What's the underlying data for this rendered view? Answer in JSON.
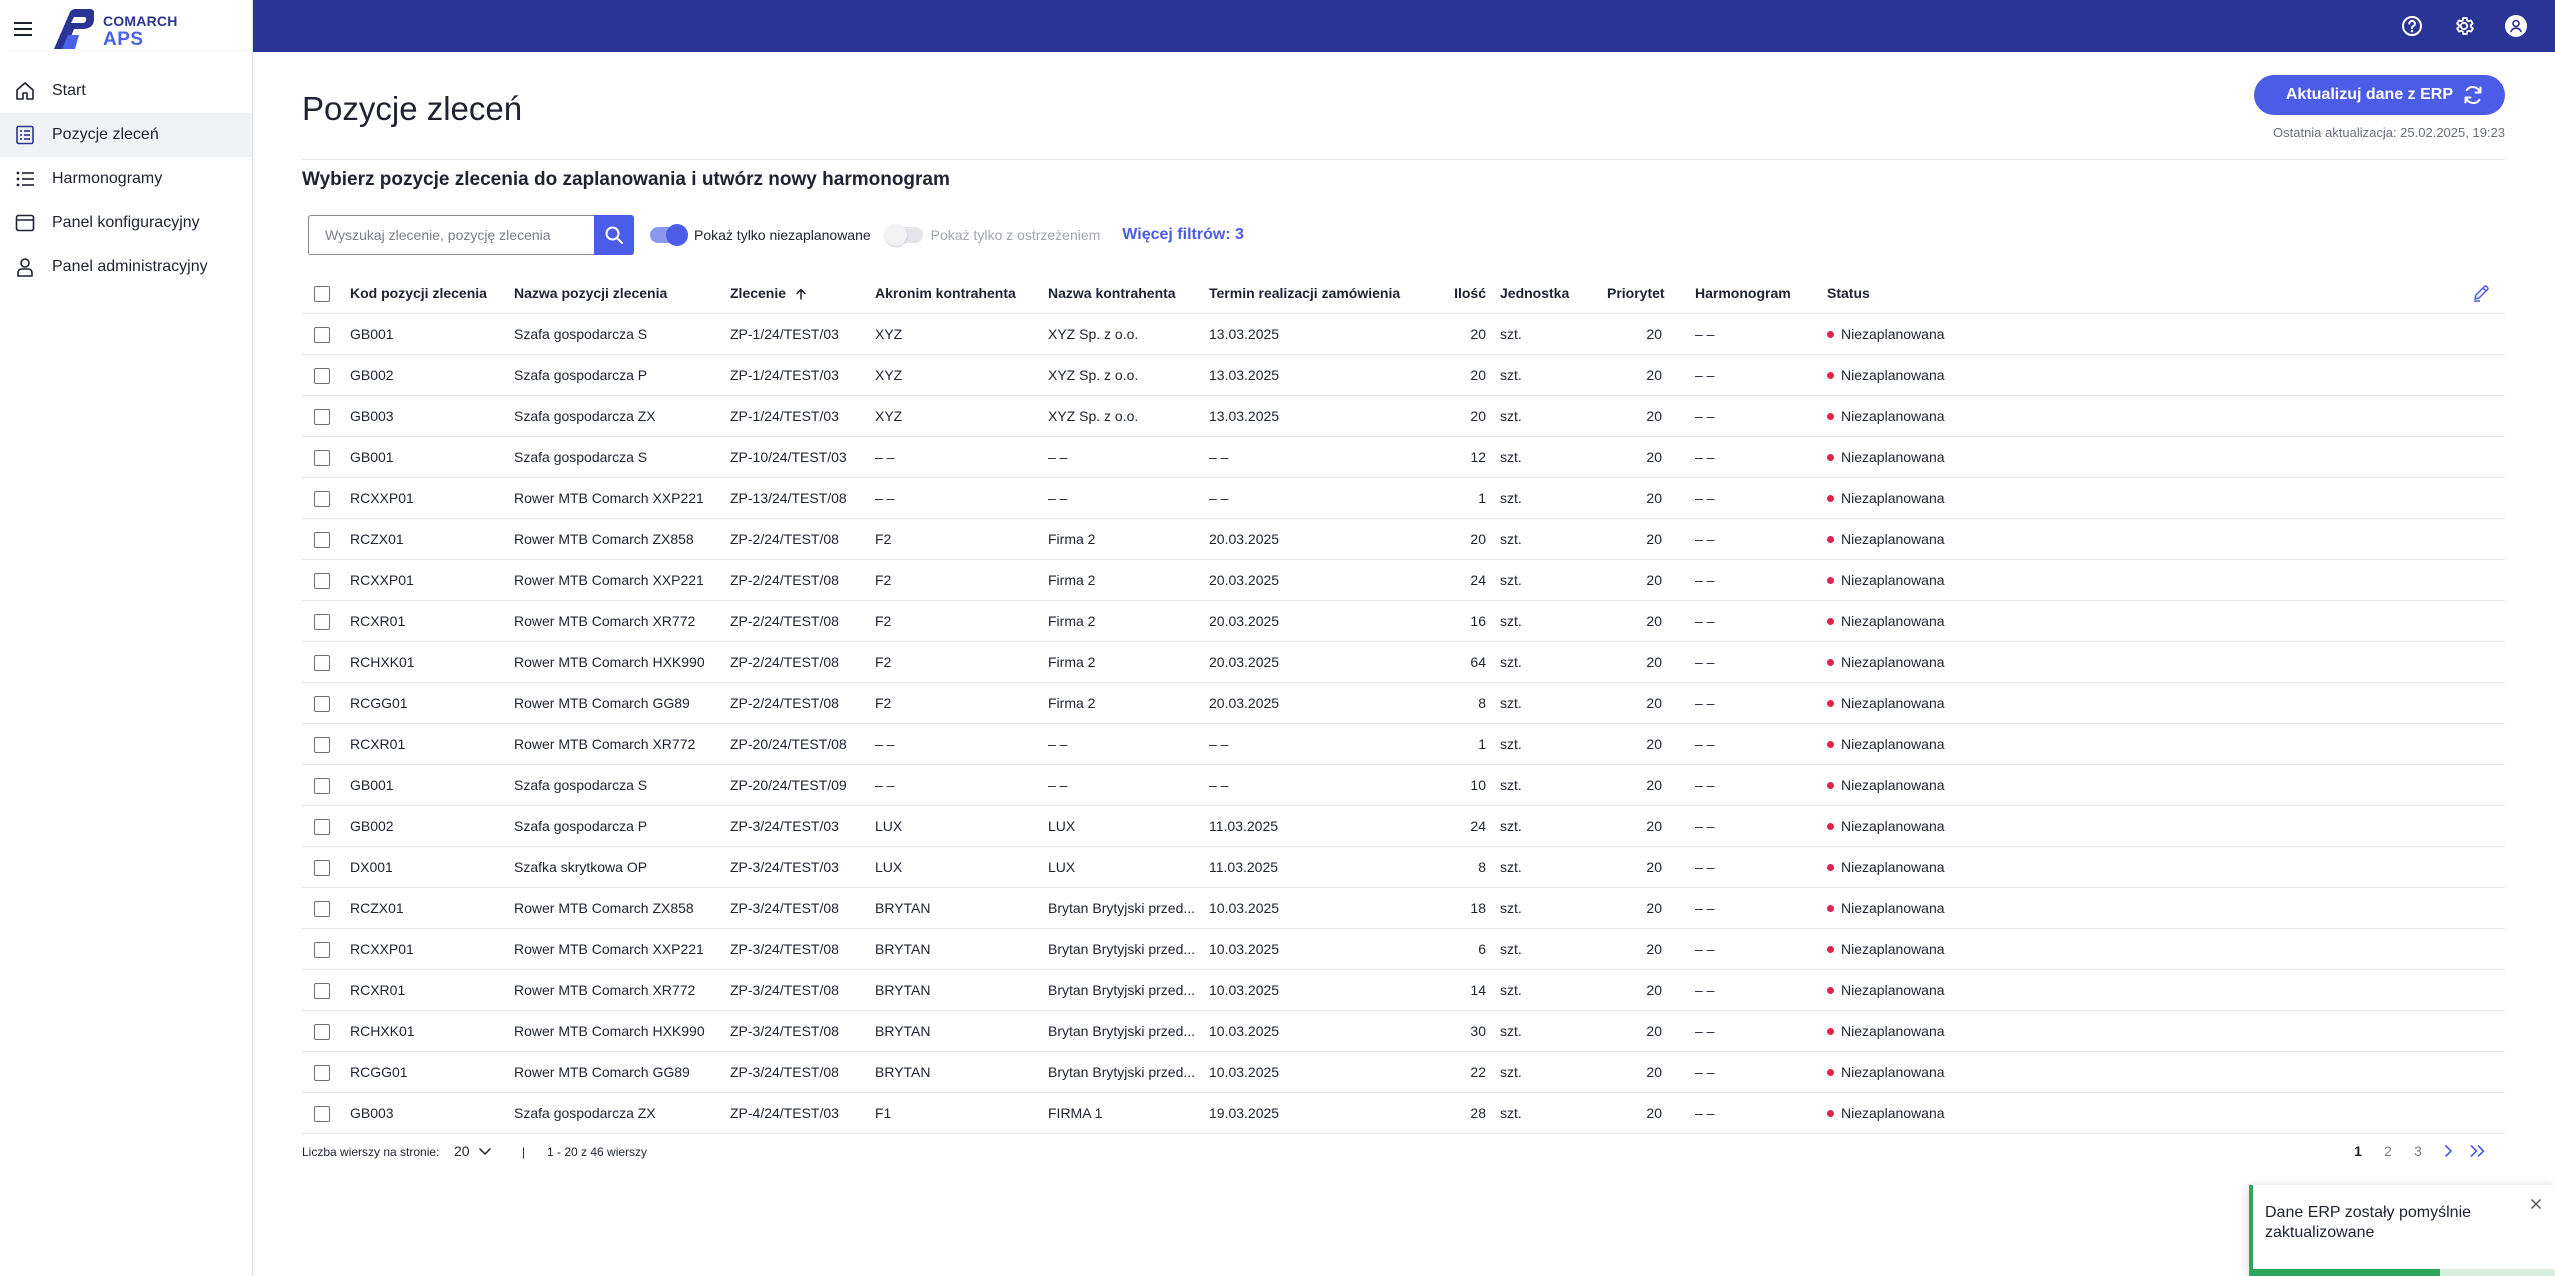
{
  "app": {
    "logo_line1": "COMARCH",
    "logo_line2": "APS"
  },
  "sidebar": {
    "items": [
      {
        "label": "Start",
        "icon": "home-icon"
      },
      {
        "label": "Pozycje zleceń",
        "icon": "list-doc-icon",
        "active": true
      },
      {
        "label": "Harmonogramy",
        "icon": "bullet-list-icon"
      },
      {
        "label": "Panel konfiguracyjny",
        "icon": "window-icon"
      },
      {
        "label": "Panel administracyjny",
        "icon": "person-icon"
      }
    ]
  },
  "header": {
    "title": "Pozycje zleceń",
    "erp_button": "Aktualizuj dane z ERP",
    "last_update": "Ostatnia aktualizacja: 25.02.2025, 19:23",
    "subtitle": "Wybierz pozycje zlecenia do zaplanowania i utwórz nowy harmonogram"
  },
  "filters": {
    "search_placeholder": "Wyszukaj zlecenie, pozycję zlecenia",
    "toggle_unplanned": "Pokaż tylko niezaplanowane",
    "toggle_unplanned_on": true,
    "toggle_warning": "Pokaż tylko z ostrzeżeniem",
    "toggle_warning_on": false,
    "more_filters": "Więcej filtrów: 3"
  },
  "table": {
    "columns": {
      "kod": "Kod pozycji zlecenia",
      "nazwa": "Nazwa pozycji zlecenia",
      "zlecenie": "Zlecenie",
      "akronim": "Akronim kontrahenta",
      "nazwa_kontr": "Nazwa kontrahenta",
      "termin": "Termin realizacji zamówienia",
      "ilosc": "Ilość",
      "jednostka": "Jednostka",
      "priorytet": "Priorytet",
      "harmonogram": "Harmonogram",
      "status": "Status"
    },
    "sorted_by": "zlecenie",
    "status_color": "#e0234e",
    "rows": [
      [
        "GB001",
        "Szafa gospodarcza S",
        "ZP-1/24/TEST/03",
        "XYZ",
        "XYZ Sp. z o.o.",
        "13.03.2025",
        "20",
        "szt.",
        "20",
        "– –",
        "Niezaplanowana"
      ],
      [
        "GB002",
        "Szafa gospodarcza P",
        "ZP-1/24/TEST/03",
        "XYZ",
        "XYZ Sp. z o.o.",
        "13.03.2025",
        "20",
        "szt.",
        "20",
        "– –",
        "Niezaplanowana"
      ],
      [
        "GB003",
        "Szafa gospodarcza ZX",
        "ZP-1/24/TEST/03",
        "XYZ",
        "XYZ Sp. z o.o.",
        "13.03.2025",
        "20",
        "szt.",
        "20",
        "– –",
        "Niezaplanowana"
      ],
      [
        "GB001",
        "Szafa gospodarcza S",
        "ZP-10/24/TEST/03",
        "– –",
        "– –",
        "– –",
        "12",
        "szt.",
        "20",
        "– –",
        "Niezaplanowana"
      ],
      [
        "RCXXP01",
        "Rower MTB Comarch XXP221",
        "ZP-13/24/TEST/08",
        "– –",
        "– –",
        "– –",
        "1",
        "szt.",
        "20",
        "– –",
        "Niezaplanowana"
      ],
      [
        "RCZX01",
        "Rower MTB Comarch ZX858",
        "ZP-2/24/TEST/08",
        "F2",
        "Firma 2",
        "20.03.2025",
        "20",
        "szt.",
        "20",
        "– –",
        "Niezaplanowana"
      ],
      [
        "RCXXP01",
        "Rower MTB Comarch XXP221",
        "ZP-2/24/TEST/08",
        "F2",
        "Firma 2",
        "20.03.2025",
        "24",
        "szt.",
        "20",
        "– –",
        "Niezaplanowana"
      ],
      [
        "RCXR01",
        "Rower MTB Comarch XR772",
        "ZP-2/24/TEST/08",
        "F2",
        "Firma 2",
        "20.03.2025",
        "16",
        "szt.",
        "20",
        "– –",
        "Niezaplanowana"
      ],
      [
        "RCHXK01",
        "Rower MTB Comarch HXK990",
        "ZP-2/24/TEST/08",
        "F2",
        "Firma 2",
        "20.03.2025",
        "64",
        "szt.",
        "20",
        "– –",
        "Niezaplanowana"
      ],
      [
        "RCGG01",
        "Rower MTB Comarch GG89",
        "ZP-2/24/TEST/08",
        "F2",
        "Firma 2",
        "20.03.2025",
        "8",
        "szt.",
        "20",
        "– –",
        "Niezaplanowana"
      ],
      [
        "RCXR01",
        "Rower MTB Comarch XR772",
        "ZP-20/24/TEST/08",
        "– –",
        "– –",
        "– –",
        "1",
        "szt.",
        "20",
        "– –",
        "Niezaplanowana"
      ],
      [
        "GB001",
        "Szafa gospodarcza S",
        "ZP-20/24/TEST/09",
        "– –",
        "– –",
        "– –",
        "10",
        "szt.",
        "20",
        "– –",
        "Niezaplanowana"
      ],
      [
        "GB002",
        "Szafa gospodarcza P",
        "ZP-3/24/TEST/03",
        "LUX",
        "LUX",
        "11.03.2025",
        "24",
        "szt.",
        "20",
        "– –",
        "Niezaplanowana"
      ],
      [
        "DX001",
        "Szafka skrytkowa OP",
        "ZP-3/24/TEST/03",
        "LUX",
        "LUX",
        "11.03.2025",
        "8",
        "szt.",
        "20",
        "– –",
        "Niezaplanowana"
      ],
      [
        "RCZX01",
        "Rower MTB Comarch ZX858",
        "ZP-3/24/TEST/08",
        "BRYTAN",
        "Brytan Brytyjski przed...",
        "10.03.2025",
        "18",
        "szt.",
        "20",
        "– –",
        "Niezaplanowana"
      ],
      [
        "RCXXP01",
        "Rower MTB Comarch XXP221",
        "ZP-3/24/TEST/08",
        "BRYTAN",
        "Brytan Brytyjski przed...",
        "10.03.2025",
        "6",
        "szt.",
        "20",
        "– –",
        "Niezaplanowana"
      ],
      [
        "RCXR01",
        "Rower MTB Comarch XR772",
        "ZP-3/24/TEST/08",
        "BRYTAN",
        "Brytan Brytyjski przed...",
        "10.03.2025",
        "14",
        "szt.",
        "20",
        "– –",
        "Niezaplanowana"
      ],
      [
        "RCHXK01",
        "Rower MTB Comarch HXK990",
        "ZP-3/24/TEST/08",
        "BRYTAN",
        "Brytan Brytyjski przed...",
        "10.03.2025",
        "30",
        "szt.",
        "20",
        "– –",
        "Niezaplanowana"
      ],
      [
        "RCGG01",
        "Rower MTB Comarch GG89",
        "ZP-3/24/TEST/08",
        "BRYTAN",
        "Brytan Brytyjski przed...",
        "10.03.2025",
        "22",
        "szt.",
        "20",
        "– –",
        "Niezaplanowana"
      ],
      [
        "GB003",
        "Szafa gospodarcza ZX",
        "ZP-4/24/TEST/03",
        "F1",
        "FIRMA 1",
        "19.03.2025",
        "28",
        "szt.",
        "20",
        "– –",
        "Niezaplanowana"
      ]
    ]
  },
  "pagination": {
    "rows_per_page_label": "Liczba wierszy na stronie:",
    "rows_per_page": "20",
    "separator": "|",
    "range": "1 - 20 z 46 wierszy",
    "pages": [
      "1",
      "2",
      "3"
    ],
    "current_page": "1"
  },
  "toast": {
    "message": "Dane ERP zostały pomyślnie zaktualizowane",
    "progress": 0.62
  },
  "colors": {
    "topbar": "#2a3494",
    "accent": "#4b5ce6",
    "status_unplanned": "#e0234e",
    "success": "#2fa75a"
  }
}
